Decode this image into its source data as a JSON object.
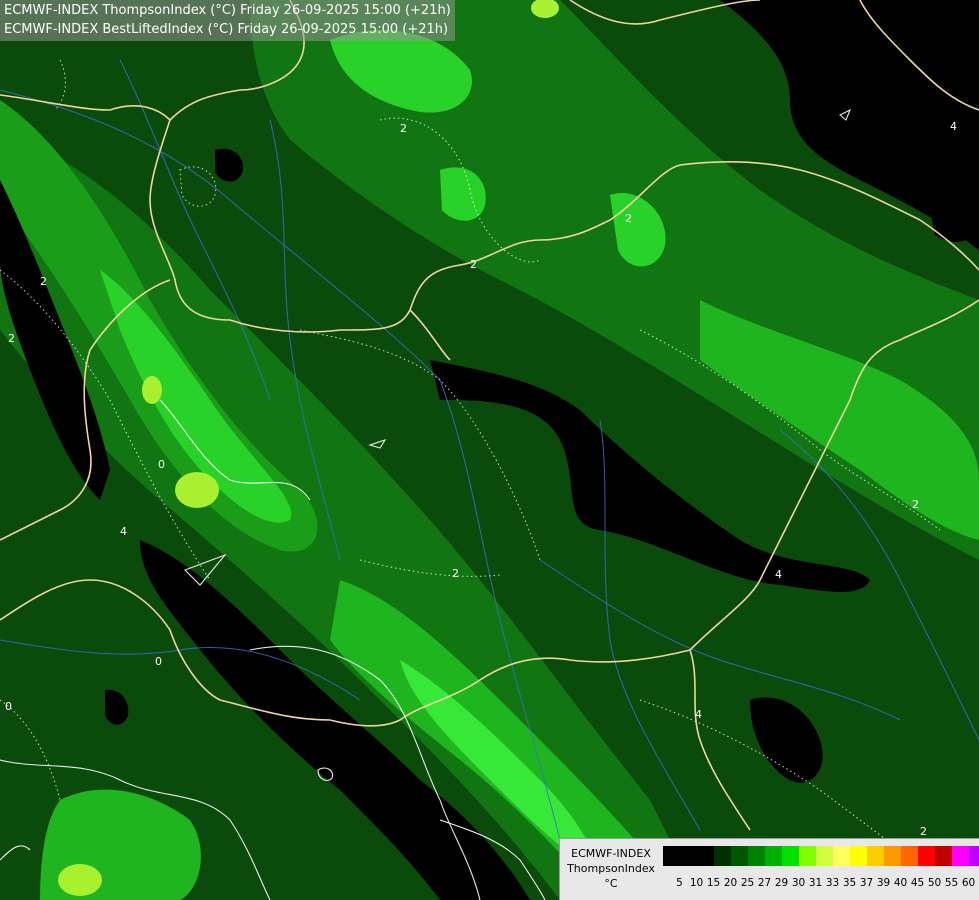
{
  "header": {
    "line1": "ECMWF-INDEX ThompsonIndex (°C) Friday 26-09-2025 15:00 (+21h)",
    "line2": "ECMWF-INDEX BestLiftedIndex (°C) Friday 26-09-2025 15:00 (+21h)"
  },
  "legend": {
    "model": "ECMWF-INDEX",
    "parameter": "ThompsonIndex",
    "unit": "°C",
    "colors": [
      "#000000",
      "#000000",
      "#000000",
      "#002f00",
      "#005900",
      "#008000",
      "#00b000",
      "#00e000",
      "#80ff00",
      "#d0ff40",
      "#ffff60",
      "#ffff00",
      "#ffcc00",
      "#ff9900",
      "#ff6600",
      "#ff0000",
      "#c00000",
      "#ff00ff",
      "#c000ff",
      "#9000ff",
      "#6000ff",
      "#0000ff"
    ],
    "ticks": [
      "5",
      "10",
      "15",
      "20",
      "25",
      "27",
      "29",
      "30",
      "31",
      "33",
      "35",
      "37",
      "39",
      "40",
      "45",
      "50",
      "55",
      "60"
    ]
  },
  "contour_labels": [
    "2",
    "2",
    "2",
    "2",
    "2",
    "2",
    "2",
    "2",
    "4",
    "4",
    "4",
    "4",
    "0",
    "0",
    "0"
  ]
}
